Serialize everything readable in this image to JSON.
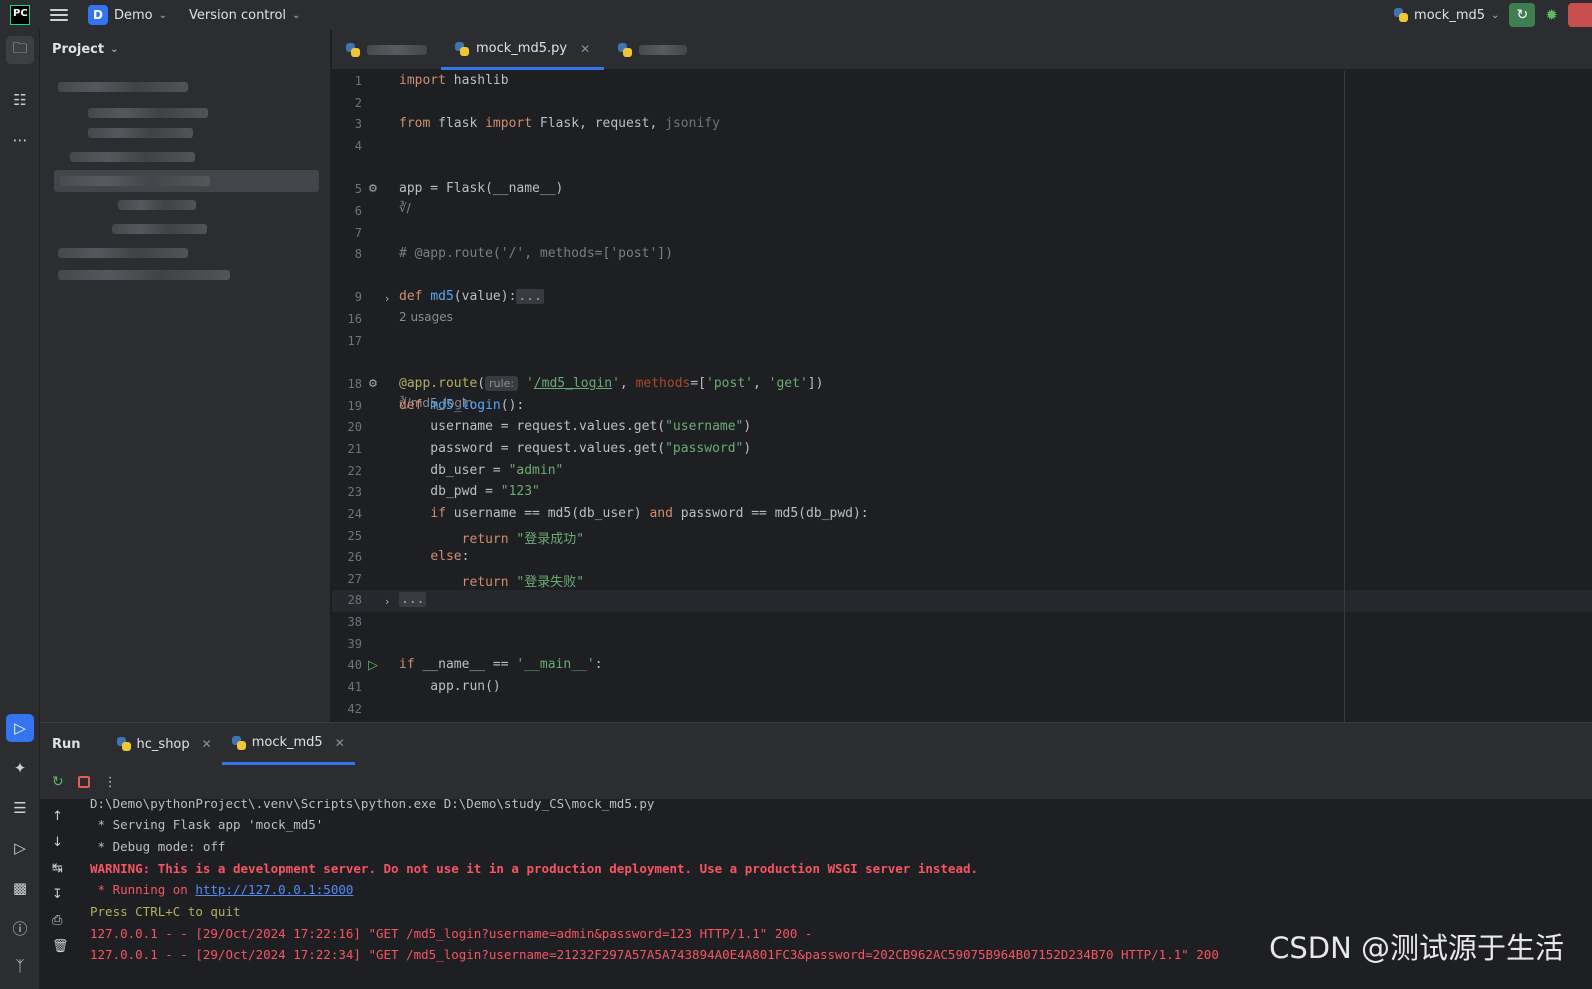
{
  "titlebar": {
    "logo": "PC",
    "project_badge": "D",
    "project_name": "Demo",
    "version_control": "Version control",
    "run_config": "mock_md5"
  },
  "project_panel": {
    "title": "Project"
  },
  "tabs": [
    {
      "label": "mock_md5.py",
      "active": true
    }
  ],
  "editor": {
    "hint_route_root": "/",
    "hint_usages": "2 usages",
    "hint_route_login": "/md5_login",
    "inlay_rule": "rule:",
    "lines": [
      {
        "n": "1",
        "code": "import hashlib"
      },
      {
        "n": "2",
        "code": ""
      },
      {
        "n": "3",
        "code": "from flask import Flask, request, jsonify"
      },
      {
        "n": "4",
        "code": ""
      },
      {
        "n": "5",
        "code": "app = Flask(__name__)"
      },
      {
        "n": "6",
        "code": ""
      },
      {
        "n": "7",
        "code": ""
      },
      {
        "n": "8",
        "code": "# @app.route('/', methods=['post'])"
      },
      {
        "n": "9",
        "code": "def md5(value):..."
      },
      {
        "n": "16",
        "code": ""
      },
      {
        "n": "17",
        "code": ""
      },
      {
        "n": "18",
        "code": "@app.route('/md5_login', methods=['post', 'get'])"
      },
      {
        "n": "19",
        "code": "def md5_login():"
      },
      {
        "n": "20",
        "code": "    username = request.values.get(\"username\")"
      },
      {
        "n": "21",
        "code": "    password = request.values.get(\"password\")"
      },
      {
        "n": "22",
        "code": "    db_user = \"admin\""
      },
      {
        "n": "23",
        "code": "    db_pwd = \"123\""
      },
      {
        "n": "24",
        "code": "    if username == md5(db_user) and password == md5(db_pwd):"
      },
      {
        "n": "25",
        "code": "        return \"登录成功\""
      },
      {
        "n": "26",
        "code": "    else:"
      },
      {
        "n": "27",
        "code": "        return \"登录失败\""
      },
      {
        "n": "28",
        "code": "..."
      },
      {
        "n": "38",
        "code": ""
      },
      {
        "n": "39",
        "code": ""
      },
      {
        "n": "40",
        "code": "if __name__ == '__main__':"
      },
      {
        "n": "41",
        "code": "    app.run()"
      },
      {
        "n": "42",
        "code": ""
      }
    ]
  },
  "run_panel": {
    "title": "Run",
    "tabs": [
      {
        "label": "hc_shop"
      },
      {
        "label": "mock_md5"
      }
    ],
    "console": {
      "l0": "D:\\Demo\\pythonProject\\.venv\\Scripts\\python.exe D:\\Demo\\study_CS\\mock_md5.py",
      "l1": " * Serving Flask app 'mock_md5'",
      "l2": " * Debug mode: off",
      "l3": "WARNING: This is a development server. Do not use it in a production deployment. Use a production WSGI server instead.",
      "l4_prefix": " * Running on ",
      "l4_link": "http://127.0.0.1:5000",
      "l5": "Press CTRL+C to quit",
      "l6": "127.0.0.1 - - [29/Oct/2024 17:22:16] \"GET /md5_login?username=admin&password=123 HTTP/1.1\" 200 -",
      "l7": "127.0.0.1 - - [29/Oct/2024 17:22:34] \"GET /md5_login?username=21232F297A57A5A743894A0E4A801FC3&password=202CB962AC59075B964B07152D234B70 HTTP/1.1\" 200"
    }
  },
  "watermark": "CSDN @测试源于生活"
}
